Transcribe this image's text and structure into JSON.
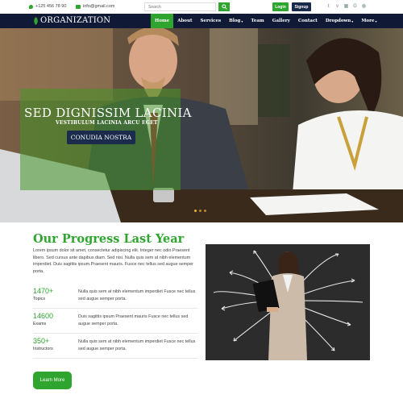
{
  "topbar": {
    "phone": "+125 456 78 90",
    "email": "info@gmail.com",
    "search_placeholder": "Search",
    "login_label": "Login",
    "signup_label": "Signup",
    "social_icons": [
      "twitter-icon",
      "vimeo-icon",
      "youtube-icon",
      "google-icon",
      "dribbble-icon"
    ]
  },
  "navbar": {
    "logo_text": "ORGANIZATION",
    "items": [
      {
        "label": "Home",
        "active": true
      },
      {
        "label": "About"
      },
      {
        "label": "Services"
      },
      {
        "label": "Blog"
      },
      {
        "label": "Team"
      },
      {
        "label": "Gallery"
      },
      {
        "label": "Contact"
      },
      {
        "label": "Dropdown"
      },
      {
        "label": "More"
      }
    ]
  },
  "hero": {
    "title": "SED DIGNISSIM LACINIA",
    "subtitle": "VESTIBULUM LACINIA ARCU EGET",
    "button_label": "CONUDIA NOSTRA",
    "slide_count": 3
  },
  "progress": {
    "title": "Our Progress Last Year",
    "intro": "Lorem ipsum dolor sit amet, consectetur adipiscing elit. Integer nec odio.Praesent libero. Sed cursus ante dapibus diam. Sed nisi. Nulla quis sem at nibh elementum imperdiet. Duis sagittis ipsum.Praesent mauris. Fusce nec tellus sed augue semper porta.",
    "stats": [
      {
        "value": "1470+",
        "label": "Topics",
        "text": "Nulla quis sem at nibh elementum imperdiet Fusce nec tellus sed augue semper porta."
      },
      {
        "value": "14600",
        "label": "Exams",
        "text": "Duis sagittis ipsum Praesent mauris Fusce nec tellus sed augue semper porta."
      },
      {
        "value": "350+",
        "label": "Instructors",
        "text": "Nulla quis sem at nibh elementum imperdiet Fusce nec tellus sed augue semper porta."
      }
    ],
    "button_label": "Learn More"
  },
  "colors": {
    "accent": "#2fa52f",
    "navy": "#101a36"
  }
}
